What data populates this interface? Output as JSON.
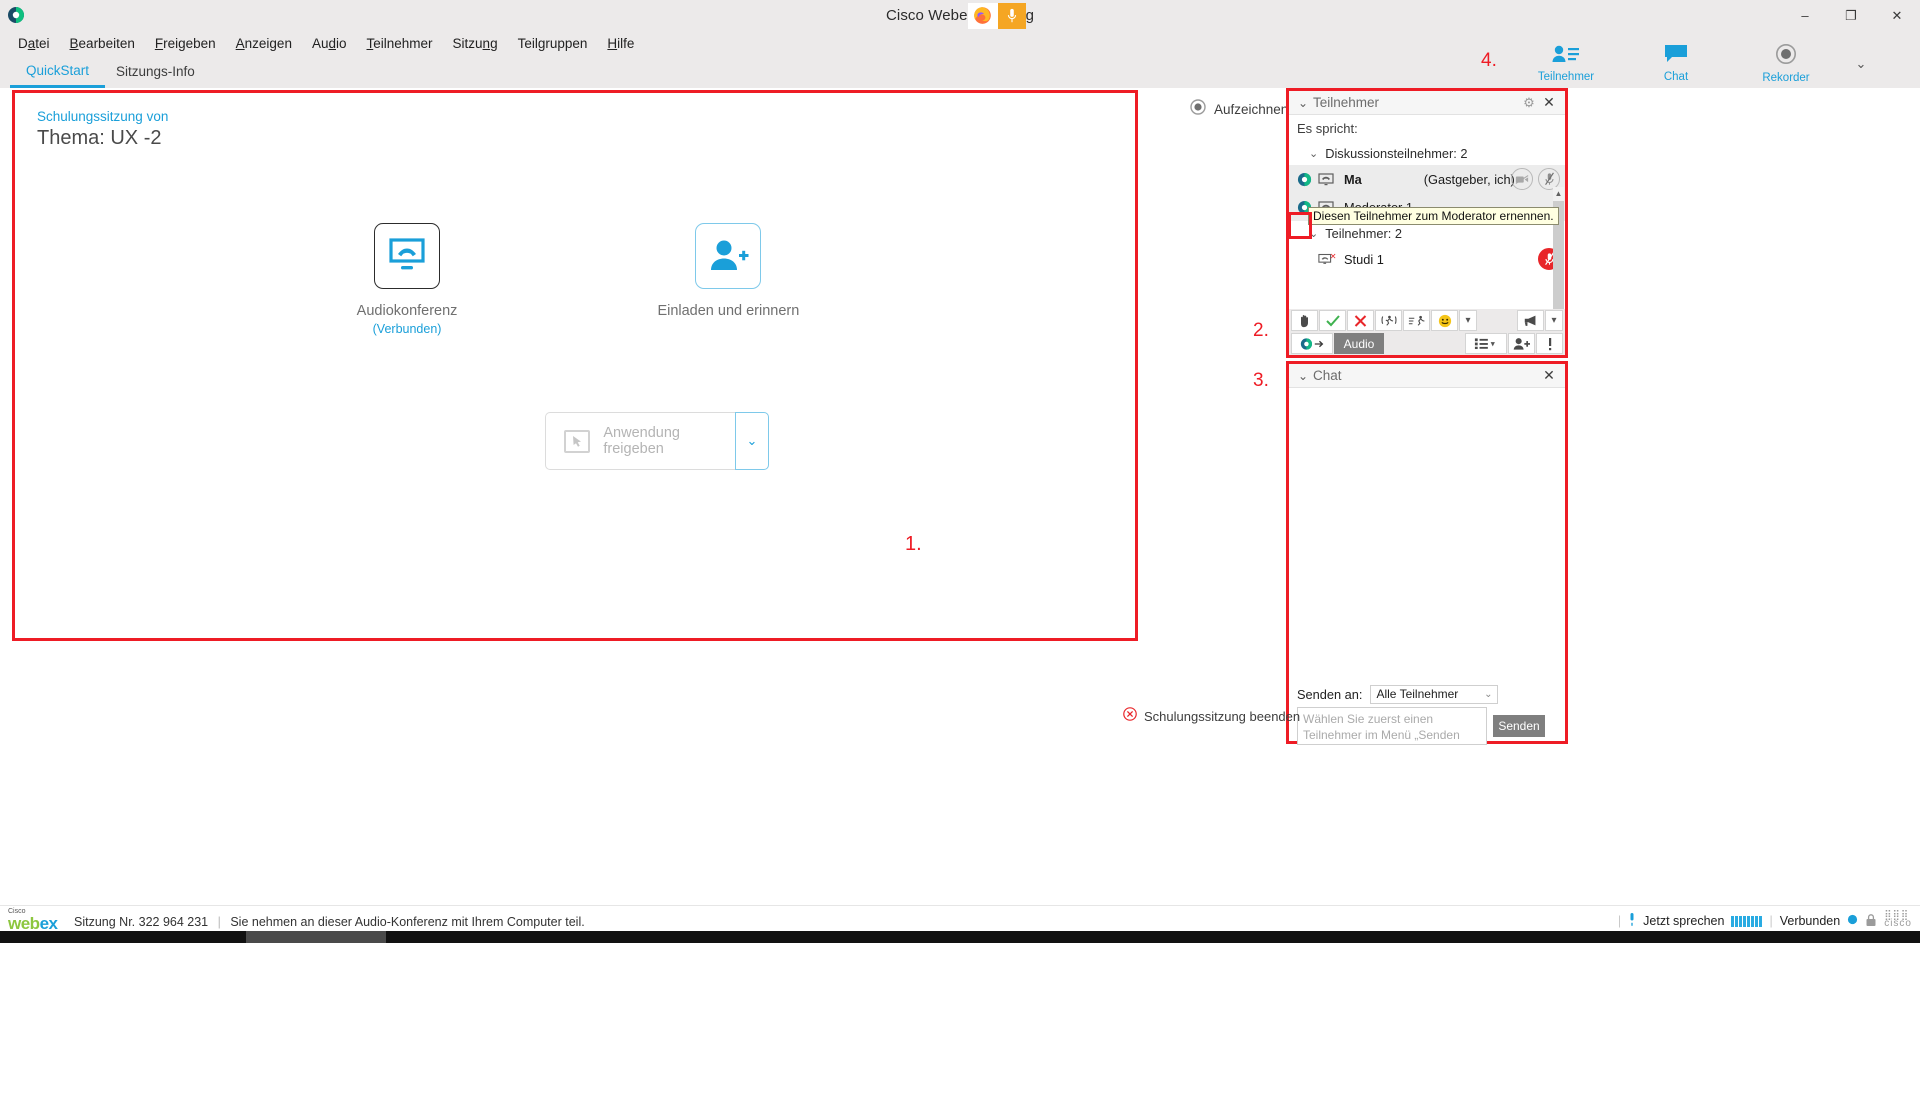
{
  "window": {
    "title_left": "Cisco Webe",
    "title_right": "g",
    "app_icon": "webex-icon",
    "overlay_icons": [
      "firefox-icon",
      "microphone-icon"
    ],
    "minimize": "–",
    "maximize": "❐",
    "close": "✕"
  },
  "menu": {
    "items": [
      {
        "pre": "D",
        "acc": "a",
        "post": "tei"
      },
      {
        "pre": "",
        "acc": "B",
        "post": "earbeiten"
      },
      {
        "pre": "",
        "acc": "F",
        "post": "reigeben"
      },
      {
        "pre": "",
        "acc": "A",
        "post": "nzeigen"
      },
      {
        "pre": "Au",
        "acc": "d",
        "post": "io"
      },
      {
        "pre": "",
        "acc": "T",
        "post": "eilnehmer"
      },
      {
        "pre": "Sitzu",
        "acc": "n",
        "post": "g"
      },
      {
        "pre": "Teil",
        "acc": "g",
        "post": "ruppen"
      },
      {
        "pre": "",
        "acc": "H",
        "post": "ilfe"
      }
    ]
  },
  "tabs": {
    "quickstart": "QuickStart",
    "session_info": "Sitzungs-Info"
  },
  "panel_tabs": {
    "participants": "Teilnehmer",
    "chat": "Chat",
    "recorder": "Rekorder",
    "chevron": "⌄"
  },
  "quickstart": {
    "subtitle": "Schulungssitzung von",
    "title": "Thema: UX -2",
    "audio": {
      "label": "Audiokonferenz",
      "status": "(Verbunden)",
      "icon": "audio-conference-icon"
    },
    "invite": {
      "label": "Einladen und erinnern",
      "icon": "invite-person-icon"
    },
    "share": {
      "label": "Anwendung freigeben",
      "icon": "share-application-icon",
      "chevron": "⌄"
    },
    "marker": "1."
  },
  "record": {
    "label": "Aufzeichnen",
    "icon": "record-circle-icon"
  },
  "participants_panel": {
    "title": "Teilnehmer",
    "collapse_chevron": "⌄",
    "gear": "⚙",
    "close": "✕",
    "speaking_label": "Es spricht:",
    "groups": [
      {
        "label": "Diskussionsteilnehmer: 2",
        "chevron": "⌄",
        "rows": [
          {
            "name": "Ma",
            "role": "(Gastgeber, ich)",
            "bold": true,
            "selected": true,
            "icons": [
              "webex-dot-icon",
              "screen-icon"
            ],
            "right": [
              "camera-off-icon",
              "mic-off-icon"
            ]
          },
          {
            "name": "Moderator 1",
            "role": "",
            "bold": false,
            "selected": true,
            "icons": [
              "webex-dot-icon",
              "screen-icon"
            ],
            "right": []
          }
        ]
      },
      {
        "label": "Teilnehmer: 2",
        "chevron": "⌄",
        "rows": [
          {
            "name": "Studi 1",
            "role": "",
            "bold": false,
            "selected": false,
            "icons": [
              "screen-x-icon"
            ],
            "right": [
              "mic-muted-red-icon"
            ]
          }
        ]
      }
    ],
    "tooltip": "Diesen Teilnehmer zum Moderator ernennen.",
    "toolbar_row1": [
      {
        "name": "raise-hand-button",
        "glyph": "✋"
      },
      {
        "name": "yes-button",
        "glyph": "✓"
      },
      {
        "name": "no-button",
        "glyph": "✕"
      },
      {
        "name": "step-out-button",
        "glyph": "((ƙ))"
      },
      {
        "name": "step-away-button",
        "glyph": "⇛"
      },
      {
        "name": "emoji-button",
        "glyph": "😊"
      },
      {
        "name": "emoji-dropdown",
        "glyph": "⌄"
      },
      {
        "name": "broadcast-button",
        "glyph": "📢"
      },
      {
        "name": "broadcast-dropdown",
        "glyph": "⌄"
      }
    ],
    "toolbar_row2": [
      {
        "name": "audio-connect-button",
        "glyph": "→"
      },
      {
        "name": "audio-tooltip",
        "glyph": "Audio"
      },
      {
        "name": "list-view-button",
        "glyph": "≡"
      },
      {
        "name": "list-view-dropdown",
        "glyph": "⌄"
      },
      {
        "name": "invite-participant-button",
        "glyph": "👤"
      },
      {
        "name": "alert-button",
        "glyph": "!"
      }
    ],
    "marker": "2."
  },
  "chat_panel": {
    "title": "Chat",
    "collapse_chevron": "⌄",
    "close": "✕",
    "send_to_label": "Senden an:",
    "send_to_value": "Alle Teilnehmer",
    "send_to_chevron": "⌄",
    "input_placeholder": "Wählen Sie zuerst einen Teilnehmer im Menü „Senden an“, geben Sie",
    "send_button": "Senden",
    "marker": "3."
  },
  "panel_tabs_marker": "4.",
  "end_session": {
    "label": "Schulungssitzung beenden",
    "icon": "close-circle-icon"
  },
  "status": {
    "logo_cisco": "Cisco",
    "logo_web": "web",
    "logo_ex": "ex",
    "session": "Sitzung Nr. 322 964 231",
    "divider": "|",
    "message": "Sie nehmen an dieser Audio-Konferenz mit Ihrem Computer teil.",
    "speak_now": "Jetzt sprechen",
    "sep": "|",
    "connected": "Verbunden",
    "cisco_mark": "cisco",
    "mic_icon": "microphone-icon",
    "lock_icon": "lock-icon"
  },
  "colors": {
    "accent": "#1a9fd9",
    "marker_red": "#ee1c25",
    "toolbar_bg": "#eceaea"
  }
}
